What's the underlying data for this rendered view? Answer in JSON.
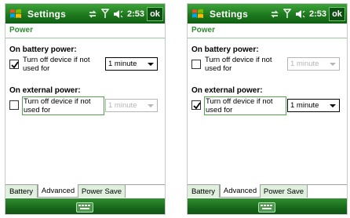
{
  "screens": [
    {
      "title": "Settings",
      "clock": "2:53",
      "ok_label": "ok",
      "heading": "Power",
      "battery": {
        "title": "On battery power:",
        "checkbox_label": "Turn off device if not used for",
        "checked": true,
        "checkbox_focused": false,
        "timeout_value": "1 minute",
        "timeout_enabled": true
      },
      "external": {
        "title": "On external power:",
        "checkbox_label": "Turn off device if not used for",
        "checked": false,
        "checkbox_focused": true,
        "timeout_value": "1 minute",
        "timeout_enabled": false
      },
      "tabs": [
        {
          "label": "Battery",
          "active": false
        },
        {
          "label": "Advanced",
          "active": true
        },
        {
          "label": "Power Save",
          "active": false
        }
      ]
    },
    {
      "title": "Settings",
      "clock": "2:53",
      "ok_label": "ok",
      "heading": "Power",
      "battery": {
        "title": "On battery power:",
        "checkbox_label": "Turn off device if not used for",
        "checked": false,
        "checkbox_focused": false,
        "timeout_value": "1 minute",
        "timeout_enabled": false
      },
      "external": {
        "title": "On external power:",
        "checkbox_label": "Turn off device if not used for",
        "checked": true,
        "checkbox_focused": true,
        "timeout_value": "1 minute",
        "timeout_enabled": true
      },
      "tabs": [
        {
          "label": "Battery",
          "active": false
        },
        {
          "label": "Advanced",
          "active": true
        },
        {
          "label": "Power Save",
          "active": false
        }
      ]
    }
  ],
  "icons": {
    "start": "windows-start-icon",
    "connectivity": "connectivity-arrows-icon",
    "signal": "signal-antenna-icon",
    "volume": "volume-speaker-icon",
    "keyboard": "keyboard-icon"
  },
  "colors": {
    "title_bar": "#1e7a1e",
    "heading": "#2e8b2e",
    "tab_inactive": "#dff0df",
    "disabled": "#b5b5b5"
  }
}
